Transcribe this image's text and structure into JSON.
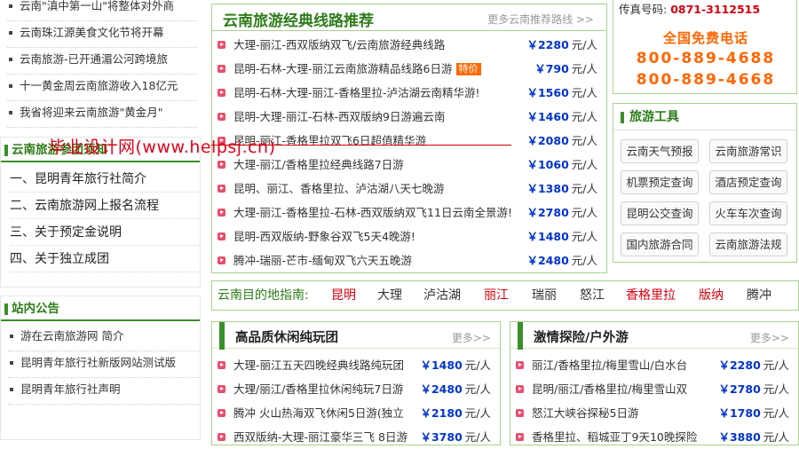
{
  "left": {
    "top_news": [
      "云南\"滇中第一山\"将整体对外商",
      "云南珠江源美食文化节将开幕",
      "云南旅游-已开通湄公河跨境旅",
      "十一黄金周云南旅游收入18亿元",
      "我省将迎来云南旅游\"黄金月\""
    ],
    "guide": {
      "title": "云南旅游参团须知",
      "items": [
        "一、昆明青年旅行社简介",
        "二、云南旅游网上报名流程",
        "三、关于预定金说明",
        "四、关于独立成团"
      ]
    },
    "notice": {
      "title": "站内公告",
      "items": [
        "游在云南旅游网 简介",
        "昆明青年旅行社新版网站测试版",
        "昆明青年旅行社声明"
      ]
    }
  },
  "classic": {
    "title": "云南旅游经典线路推荐",
    "more": "更多云南推荐路线 >>",
    "unit": "元/人",
    "routes": [
      {
        "name": "大理-丽江-西双版纳双飞/云南旅游经典线路",
        "price": "￥2280",
        "tag": ""
      },
      {
        "name": "昆明-石林-大理-丽江云南旅游精品线路6日游",
        "price": "￥790",
        "tag": "特价"
      },
      {
        "name": "昆明-石林-大理-丽江-香格里拉-泸沽湖云南精华游!",
        "price": "￥1560",
        "tag": ""
      },
      {
        "name": "昆明-大理-丽江-石林-西双版纳9日游遍云南",
        "price": "￥1460",
        "tag": ""
      },
      {
        "name": "昆明-丽江-香格里拉双飞6日超值精华游",
        "price": "￥2080",
        "tag": ""
      },
      {
        "name": "大理-丽江/香格里拉经典线路7日游",
        "price": "￥1060",
        "tag": ""
      },
      {
        "name": "昆明、丽江、香格里拉、泸沽湖八天七晚游",
        "price": "￥1380",
        "tag": ""
      },
      {
        "name": "大理-丽江-香格里拉-石林-西双版纳双飞11日云南全景游!",
        "price": "￥2780",
        "tag": ""
      },
      {
        "name": "昆明-西双版纳-野象谷双飞5天4晚游!",
        "price": "￥1480",
        "tag": ""
      },
      {
        "name": "腾冲-瑞丽-芒市-缅甸双飞六天五晚游",
        "price": "￥2480",
        "tag": ""
      }
    ]
  },
  "contact": {
    "fax_label": "传真号码:",
    "fax": "0871-3112515",
    "free_label": "全国免费电话",
    "numbers": [
      "800-889-4688",
      "800-889-4668"
    ]
  },
  "tools": {
    "title": "旅游工具",
    "items": [
      "云南天气预报",
      "云南旅游常识",
      "机票预定查询",
      "酒店预定查询",
      "昆明公交查询",
      "火车车次查询",
      "国内旅游合同",
      "云南旅游法规"
    ]
  },
  "destinations": {
    "label": "云南目的地指南:",
    "items": [
      {
        "name": "昆明",
        "color": "#d6000f"
      },
      {
        "name": "大理",
        "color": "#333333"
      },
      {
        "name": "泸沽湖",
        "color": "#333333"
      },
      {
        "name": "丽江",
        "color": "#d6000f"
      },
      {
        "name": "瑞丽",
        "color": "#333333"
      },
      {
        "name": "怒江",
        "color": "#333333"
      },
      {
        "name": "香格里拉",
        "color": "#d6000f"
      },
      {
        "name": "版纳",
        "color": "#d6000f"
      },
      {
        "name": "腾冲",
        "color": "#333333"
      }
    ]
  },
  "leisure": {
    "title": "高品质休闲纯玩团",
    "more": "更多>>",
    "unit": "元/人",
    "routes": [
      {
        "name": "大理-丽江五天四晚经典线路纯玩团",
        "price": "￥1480"
      },
      {
        "name": "大理/丽江/香格里拉休闲纯玩7日游",
        "price": "￥2480"
      },
      {
        "name": "腾冲 火山热海双飞休闲5日游(独立",
        "price": "￥2180"
      },
      {
        "name": "西双版纳-大理-丽江豪华三飞 8日游",
        "price": "￥3780"
      }
    ]
  },
  "adventure": {
    "title": "激情探险/户外游",
    "more": "更多>>",
    "unit": "元/人",
    "routes": [
      {
        "name": "丽江/香格里拉/梅里雪山/白水台",
        "price": "￥2280"
      },
      {
        "name": "昆明/丽江/香格里拉/梅里雪山双",
        "price": "￥2780"
      },
      {
        "name": "怒江大峡谷探秘5日游",
        "price": "￥1780"
      },
      {
        "name": "香格里拉、稻城亚丁9天10晚探险",
        "price": "￥3880"
      }
    ]
  },
  "watermark": "毕业设计网(www.helpsj.cn)",
  "colors": {
    "accent_green": "#2e7d1a",
    "border_green": "#a8d08d",
    "price_blue": "#0033cc",
    "phone_orange": "#ff6600",
    "alert_red": "#d6000f"
  }
}
